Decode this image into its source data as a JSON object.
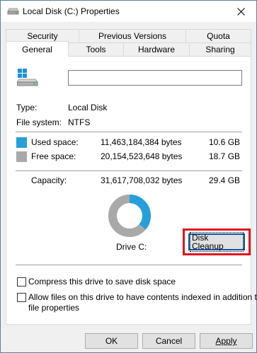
{
  "window": {
    "title": "Local Disk (C:) Properties",
    "close_icon": "close-icon"
  },
  "tabs": {
    "row1": [
      "Security",
      "Previous Versions",
      "Quota"
    ],
    "row2": [
      "General",
      "Tools",
      "Hardware",
      "Sharing"
    ],
    "active": "General"
  },
  "general": {
    "name_value": "",
    "type_label": "Type:",
    "type_value": "Local Disk",
    "fs_label": "File system:",
    "fs_value": "NTFS",
    "used_label": "Used space:",
    "used_bytes": "11,463,184,384 bytes",
    "used_gb": "10.6 GB",
    "free_label": "Free space:",
    "free_bytes": "20,154,523,648 bytes",
    "free_gb": "18.7 GB",
    "capacity_label": "Capacity:",
    "capacity_bytes": "31,617,708,032 bytes",
    "capacity_gb": "29.4 GB",
    "drive_label": "Drive C:",
    "cleanup_label": "Disk Cleanup",
    "compress_label": "Compress this drive to save disk space",
    "index_label_line1": "Allow files on this drive to have contents indexed in addition to",
    "index_label_line2": "file properties",
    "used_fraction": 0.3626
  },
  "colors": {
    "used": "#26a0da",
    "free": "#a9a9a9",
    "highlight": "#e0141e"
  },
  "buttons": {
    "ok": "OK",
    "cancel": "Cancel",
    "apply": "Apply"
  }
}
